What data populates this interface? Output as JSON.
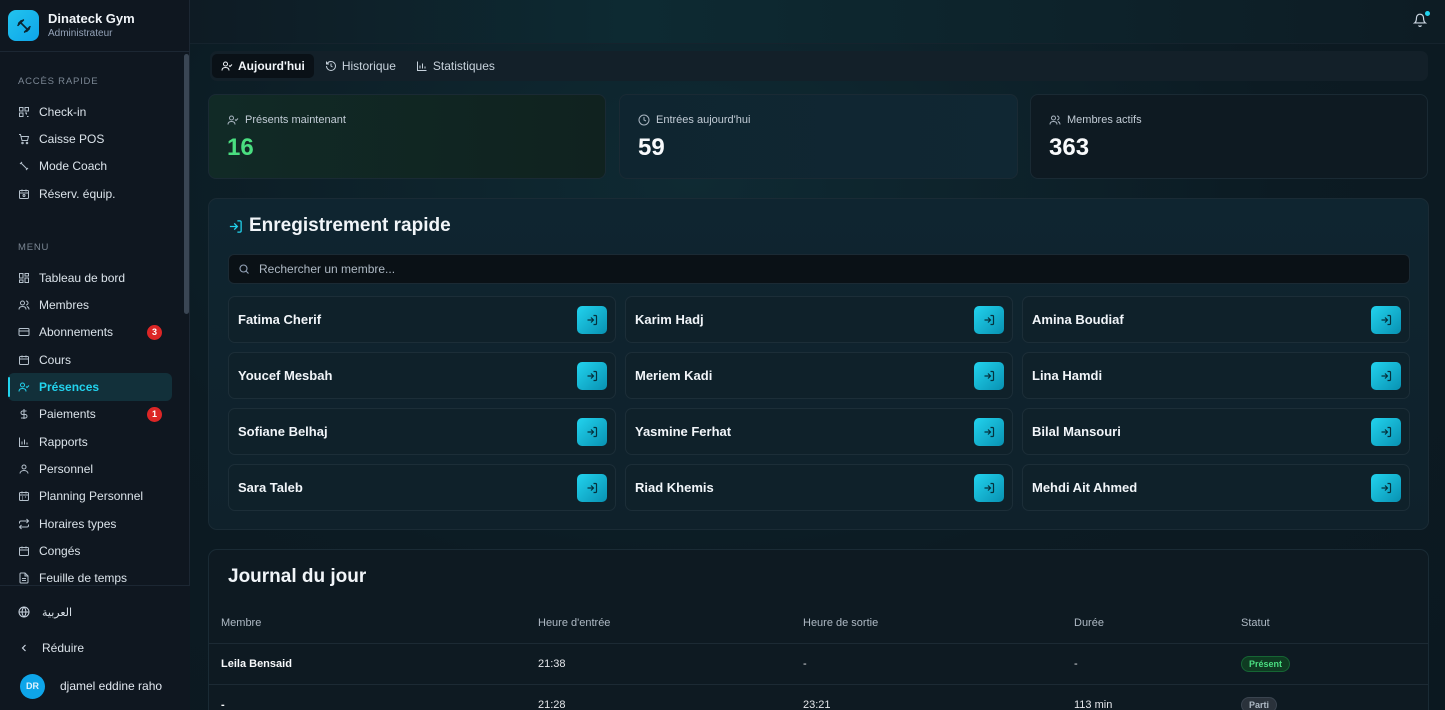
{
  "brand": {
    "name": "Dinateck Gym",
    "role": "Administrateur"
  },
  "sidebar": {
    "quick_title": "ACCÈS RAPIDE",
    "quick_items": [
      {
        "label": "Check-in",
        "icon": "scan-icon"
      },
      {
        "label": "Caisse POS",
        "icon": "cart-icon"
      },
      {
        "label": "Mode Coach",
        "icon": "dumbbell-icon"
      },
      {
        "label": "Réserv. équip.",
        "icon": "calendar-clock-icon"
      }
    ],
    "menu_title": "MENU",
    "menu_items": [
      {
        "label": "Tableau de bord",
        "icon": "dashboard-icon"
      },
      {
        "label": "Membres",
        "icon": "users-icon"
      },
      {
        "label": "Abonnements",
        "icon": "card-icon",
        "badge": "3"
      },
      {
        "label": "Cours",
        "icon": "calendar-icon"
      },
      {
        "label": "Présences",
        "icon": "user-check-icon",
        "active": true
      },
      {
        "label": "Paiements",
        "icon": "dollar-icon",
        "badge": "1"
      },
      {
        "label": "Rapports",
        "icon": "bar-chart-icon"
      },
      {
        "label": "Personnel",
        "icon": "user-icon"
      },
      {
        "label": "Planning Personnel",
        "icon": "calendar-days-icon"
      },
      {
        "label": "Horaires types",
        "icon": "repeat-icon"
      },
      {
        "label": "Congés",
        "icon": "calendar-icon"
      },
      {
        "label": "Feuille de temps",
        "icon": "file-icon"
      }
    ],
    "language": "العربية",
    "collapse": "Réduire",
    "user": {
      "initials": "DR",
      "name": "djamel eddine raho"
    }
  },
  "tabs": [
    {
      "label": "Aujourd'hui",
      "icon": "user-check-icon",
      "active": true
    },
    {
      "label": "Historique",
      "icon": "history-icon"
    },
    {
      "label": "Statistiques",
      "icon": "bar-chart-icon"
    }
  ],
  "stats": [
    {
      "label": "Présents maintenant",
      "value": "16",
      "icon": "user-check-icon"
    },
    {
      "label": "Entrées aujourd'hui",
      "value": "59",
      "icon": "clock-icon"
    },
    {
      "label": "Membres actifs",
      "value": "363",
      "icon": "users-icon"
    }
  ],
  "quick_checkin": {
    "title": "Enregistrement rapide",
    "search_placeholder": "Rechercher un membre...",
    "members": [
      "Fatima Cherif",
      "Karim Hadj",
      "Amina Boudiaf",
      "Youcef Mesbah",
      "Meriem Kadi",
      "Lina Hamdi",
      "Sofiane Belhaj",
      "Yasmine Ferhat",
      "Bilal Mansouri",
      "Sara Taleb",
      "Riad Khemis",
      "Mehdi Ait Ahmed"
    ]
  },
  "journal": {
    "title": "Journal du jour",
    "columns": [
      "Membre",
      "Heure d'entrée",
      "Heure de sortie",
      "Durée",
      "Statut"
    ],
    "rows": [
      {
        "member": "Leila Bensaid",
        "in": "21:38",
        "out": "-",
        "duration": "-",
        "status": "Présent",
        "status_type": "present"
      },
      {
        "member": "-",
        "in": "21:28",
        "out": "23:21",
        "duration": "113 min",
        "status": "Parti",
        "status_type": "gone"
      }
    ]
  },
  "colors": {
    "accent": "#22d3ee",
    "present": "#4ade80",
    "badge": "#dc2626"
  }
}
